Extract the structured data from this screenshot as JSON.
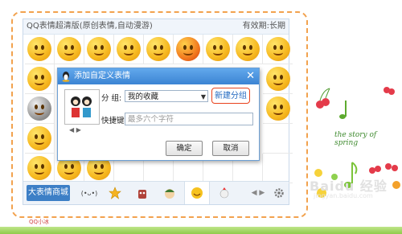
{
  "panel": {
    "title": "QQ表情超清版(原创表情,自动漫游)",
    "validity": "有效期:长期",
    "mall_label": "大表情商城",
    "tab_text": "(•ᴗ•)"
  },
  "dialog": {
    "title": "添加自定义表情",
    "group_label": "分  组:",
    "group_value": "我的收藏",
    "new_group": "新建分组",
    "shortcut_label": "快捷键:",
    "shortcut_placeholder": "最多六个字符",
    "ok": "确定",
    "cancel": "取消",
    "close_glyph": "✕"
  },
  "decor": {
    "story_text": "the story of spring",
    "watermark": "Baidu 经验",
    "watermark_url": "jingyan.baidu.com",
    "brand": "QQ小冰"
  },
  "colors": {
    "accent": "#3b84d3",
    "frame": "#f2a24e",
    "new_group_border": "#e8421d"
  }
}
